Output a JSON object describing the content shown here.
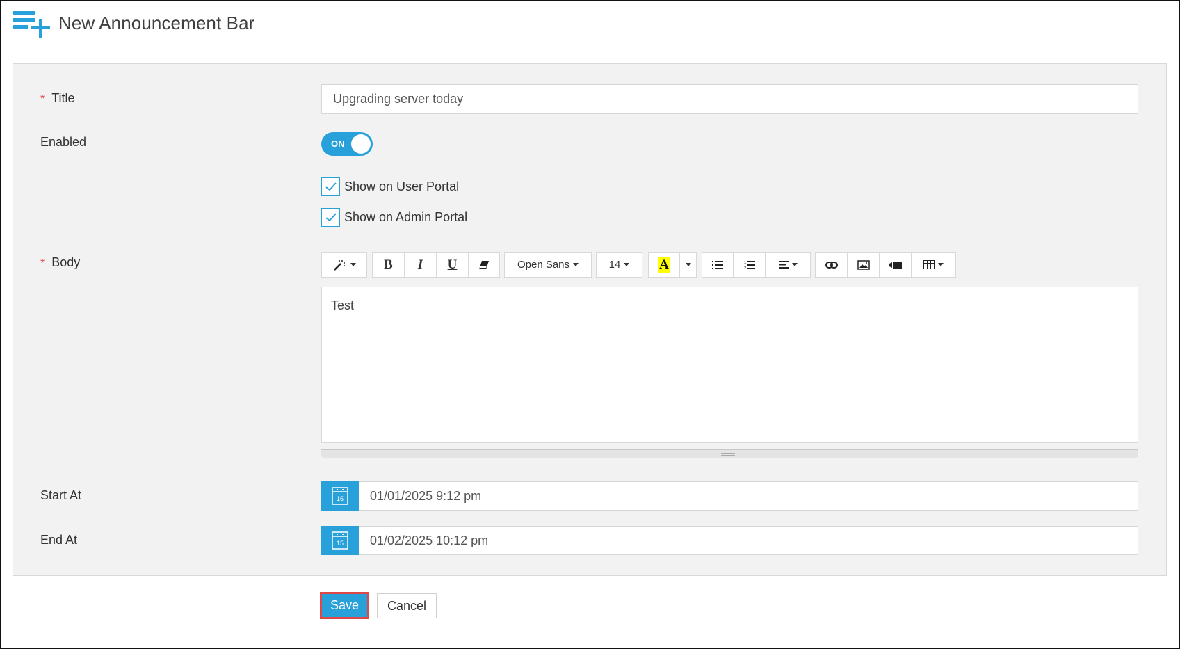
{
  "header": {
    "title": "New Announcement Bar",
    "icon": "playlist-add-icon"
  },
  "form": {
    "title": {
      "label": "Title",
      "required": true,
      "value": "Upgrading server today"
    },
    "enabled": {
      "label": "Enabled",
      "toggle_label": "ON",
      "value": true
    },
    "checkboxes": [
      {
        "label": "Show on User Portal",
        "checked": true
      },
      {
        "label": "Show on Admin Portal",
        "checked": true
      }
    ],
    "body": {
      "label": "Body",
      "required": true,
      "value": "Test",
      "toolbar": {
        "style_icon": "magic-wand-icon",
        "bold": "B",
        "italic": "I",
        "underline": "U",
        "clear_format_icon": "eraser-icon",
        "font_family": "Open Sans",
        "font_size": "14",
        "color_letter": "A",
        "highlight_color": "#ffff00",
        "unordered_list_icon": "bullet-list-icon",
        "ordered_list_icon": "numbered-list-icon",
        "align_icon": "align-left-icon",
        "link_icon": "link-icon",
        "picture_icon": "image-icon",
        "video_icon": "video-icon",
        "table_icon": "table-icon"
      }
    },
    "start_at": {
      "label": "Start At",
      "value": "01/01/2025 9:12 pm",
      "calendar_day": "15"
    },
    "end_at": {
      "label": "End At",
      "value": "01/02/2025 10:12 pm",
      "calendar_day": "15"
    }
  },
  "actions": {
    "save_label": "Save",
    "cancel_label": "Cancel"
  },
  "colors": {
    "accent": "#28a0da",
    "required": "#e05050",
    "save_outline": "#e04848",
    "panel_bg": "#f2f2f2"
  }
}
